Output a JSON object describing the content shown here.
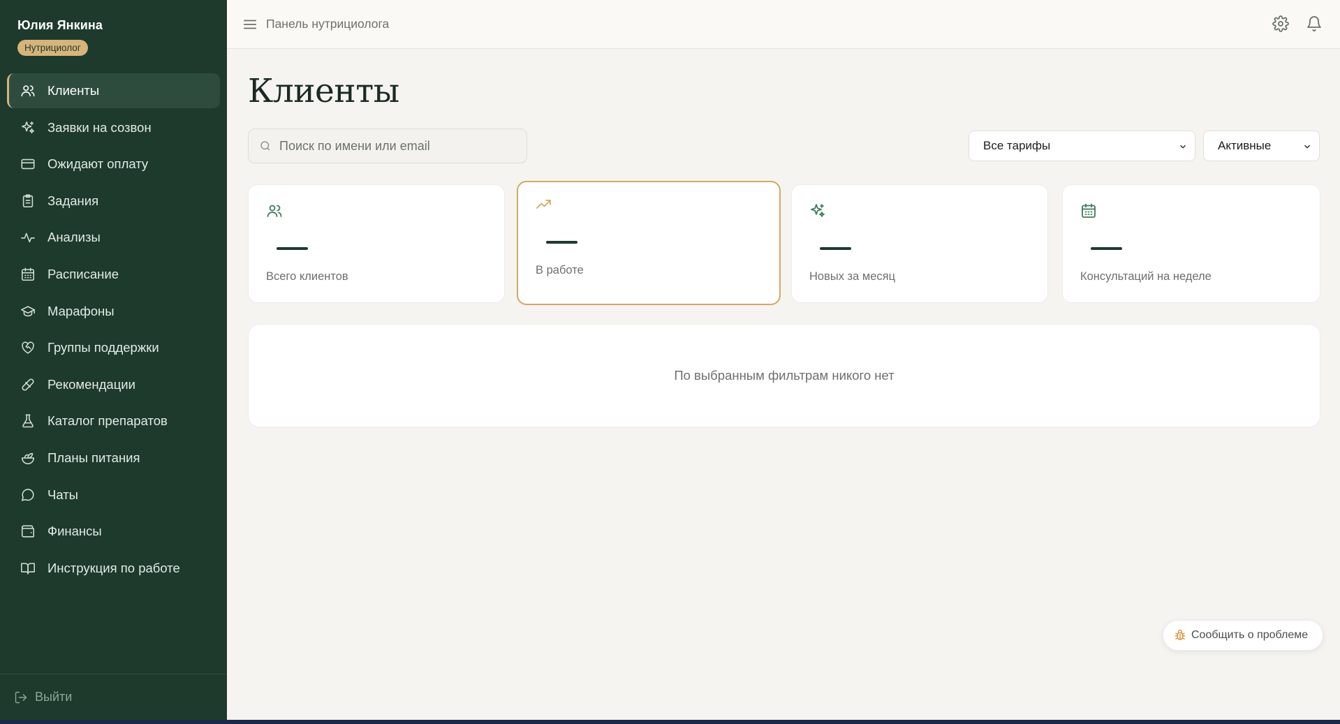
{
  "sidebar": {
    "user_name": "Юлия Янкина",
    "role_badge": "Нутрициолог",
    "items": [
      {
        "label": "Клиенты",
        "icon": "users-icon",
        "active": true
      },
      {
        "label": "Заявки на созвон",
        "icon": "sparkles-icon"
      },
      {
        "label": "Ожидают оплату",
        "icon": "credit-card-icon"
      },
      {
        "label": "Задания",
        "icon": "clipboard-icon"
      },
      {
        "label": "Анализы",
        "icon": "activity-icon"
      },
      {
        "label": "Расписание",
        "icon": "calendar-icon"
      },
      {
        "label": "Марафоны",
        "icon": "graduation-cap-icon"
      },
      {
        "label": "Группы поддержки",
        "icon": "heart-handshake-icon"
      },
      {
        "label": "Рекомендации",
        "icon": "pill-icon"
      },
      {
        "label": "Каталог препаратов",
        "icon": "flask-icon"
      },
      {
        "label": "Планы питания",
        "icon": "salad-icon"
      },
      {
        "label": "Чаты",
        "icon": "message-circle-icon"
      },
      {
        "label": "Финансы",
        "icon": "wallet-icon"
      },
      {
        "label": "Инструкция по работе",
        "icon": "book-open-icon"
      }
    ],
    "logout_label": "Выйти"
  },
  "topbar": {
    "breadcrumb": "Панель нутрициолога"
  },
  "main": {
    "title": "Клиенты",
    "search_placeholder": "Поиск по имени или email",
    "tariff_filter": "Все тарифы",
    "status_filter": "Активные",
    "stats": [
      {
        "label": "Всего клиентов",
        "value": "—",
        "icon": "users-icon"
      },
      {
        "label": "В работе",
        "value": "—",
        "icon": "trending-up-icon"
      },
      {
        "label": "Новых за месяц",
        "value": "—",
        "icon": "sparkles-icon"
      },
      {
        "label": "Консультаций на неделе",
        "value": "—",
        "icon": "calendar-icon"
      }
    ],
    "empty_message": "По выбранным фильтрам никого нет"
  },
  "report_button": "Сообщить о проблеме",
  "colors": {
    "sidebar_bg": "#1d3a2d",
    "accent_gold": "#d7b47a",
    "stat_icon_green": "#3f7a5c",
    "highlight_border": "#d3a866"
  }
}
